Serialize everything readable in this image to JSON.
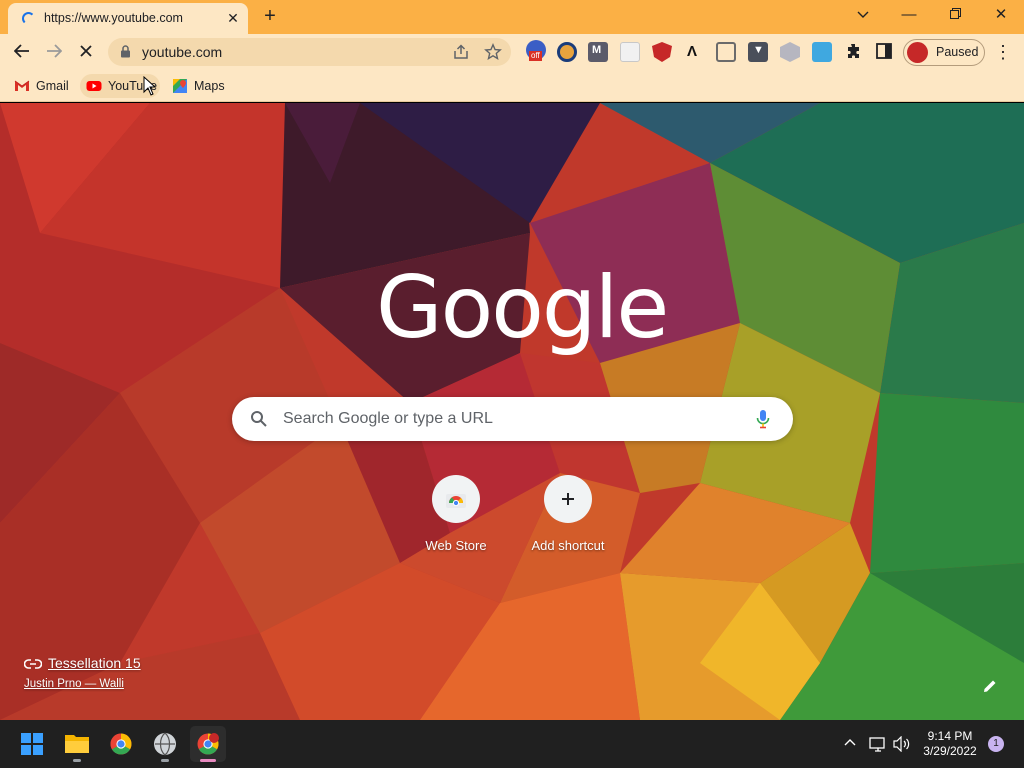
{
  "browser": {
    "tab": {
      "title": "https://www.youtube.com"
    },
    "omnibox": {
      "url": "youtube.com"
    },
    "profile": {
      "label": "Paused"
    },
    "extensions": [
      "adblock-off-icon",
      "pcloud-icon",
      "m-extension-icon",
      "blank-extension-icon",
      "shield-extension-icon",
      "a-extension-icon",
      "window-extension-icon",
      "pocket-icon",
      "cube-extension-icon",
      "cloud-extension-icon",
      "puzzle-icon",
      "side-panel-icon"
    ],
    "extension_badge": "off"
  },
  "bookmarks": [
    {
      "label": "Gmail",
      "icon": "gmail-icon"
    },
    {
      "label": "YouTube",
      "icon": "youtube-icon"
    },
    {
      "label": "Maps",
      "icon": "maps-icon"
    }
  ],
  "ntp": {
    "logo": "Google",
    "search_placeholder": "Search Google or type a URL",
    "shortcuts": [
      {
        "label": "Web Store",
        "icon": "web-store-icon"
      },
      {
        "label": "Add shortcut",
        "icon": "plus-icon"
      }
    ],
    "attribution": {
      "title": "Tessellation 15",
      "author": "Justin Prno — Walli"
    }
  },
  "taskbar": {
    "apps": [
      "windows-start-icon",
      "file-explorer-icon",
      "chrome-icon",
      "app-icon",
      "chrome-profile-icon"
    ],
    "time": "9:14 PM",
    "date": "3/29/2022",
    "notifications": "1"
  },
  "colors": {
    "titlebar": "#fbb045",
    "toolbar": "#fde7c4",
    "accent": "#1a73e8"
  }
}
